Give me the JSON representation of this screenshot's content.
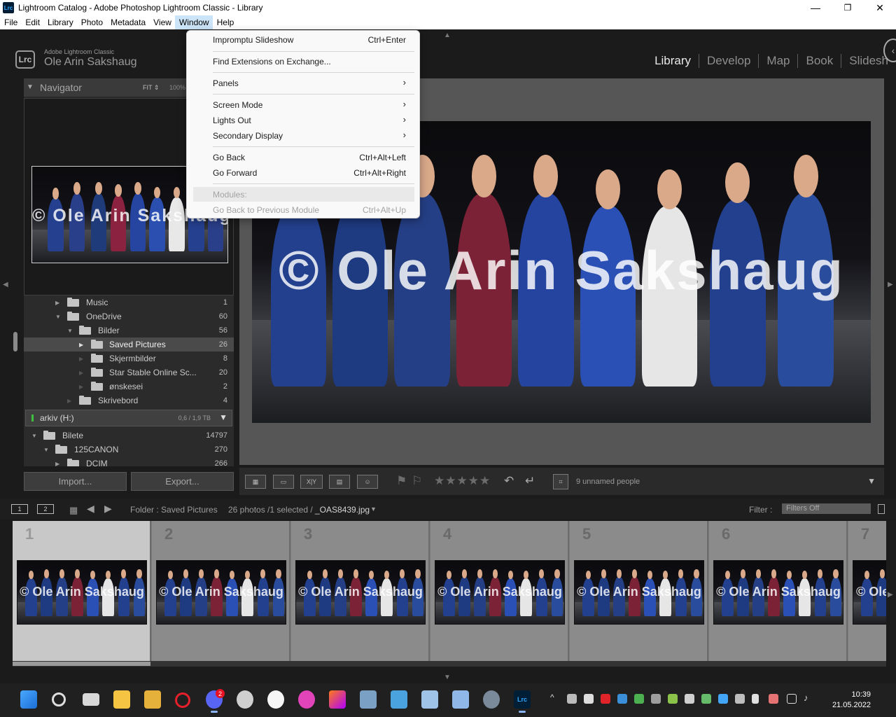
{
  "window": {
    "app_icon": "Lrc",
    "title": "Lightroom Catalog - Adobe Photoshop Lightroom Classic - Library",
    "minimize_glyph": "—",
    "maximize_glyph": "❐",
    "close_glyph": "✕"
  },
  "menubar": [
    "File",
    "Edit",
    "Library",
    "Photo",
    "Metadata",
    "View",
    "Window",
    "Help"
  ],
  "identity": {
    "badge": "Lrc",
    "product": "Adobe Lightroom Classic",
    "user": "Ole Arin Sakshaug"
  },
  "modules": [
    "Library",
    "Develop",
    "Map",
    "Book",
    "Slidesh"
  ],
  "window_menu": {
    "items": [
      {
        "label": "Impromptu Slideshow",
        "shortcut": "Ctrl+Enter"
      },
      {
        "label": "Find Extensions on Exchange...",
        "shortcut": ""
      },
      {
        "label": "Panels",
        "shortcut": "",
        "submenu": "›"
      },
      {
        "label": "Screen Mode",
        "shortcut": "",
        "submenu": "›"
      },
      {
        "label": "Lights Out",
        "shortcut": "",
        "submenu": "›"
      },
      {
        "label": "Secondary Display",
        "shortcut": "",
        "submenu": "›"
      },
      {
        "label": "Go Back",
        "shortcut": "Ctrl+Alt+Left"
      },
      {
        "label": "Go Forward",
        "shortcut": "Ctrl+Alt+Right"
      },
      {
        "label": "Modules:",
        "shortcut": ""
      },
      {
        "label": "Go Back to Previous Module",
        "shortcut": "Ctrl+Alt+Up"
      }
    ]
  },
  "navigator": {
    "title": "Navigator",
    "fit": "FIT ⇕",
    "zoom": "100%"
  },
  "folders": [
    {
      "name": "Music",
      "count": "1"
    },
    {
      "name": "OneDrive",
      "count": "60"
    },
    {
      "name": "Bilder",
      "count": "56"
    },
    {
      "name": "Saved Pictures",
      "count": "26",
      "selected": true
    },
    {
      "name": "Skjermbilder",
      "count": "8"
    },
    {
      "name": "Star Stable Online Sc...",
      "count": "20"
    },
    {
      "name": "ønskesei",
      "count": "2"
    },
    {
      "name": "Skrivebord",
      "count": "4"
    }
  ],
  "volume": {
    "name": "arkiv (H:)",
    "size": "0,6 / 1,9 TB"
  },
  "volume_folders": [
    {
      "name": "Bilete",
      "count": "14797"
    },
    {
      "name": "125CANON",
      "count": "270"
    },
    {
      "name": "DCIM",
      "count": "266"
    }
  ],
  "buttons": {
    "import": "Import...",
    "export": "Export..."
  },
  "photo": {
    "watermark": "© Ole Arin Sakshaug"
  },
  "toolbar": {
    "grid_icon": "grid-view-icon",
    "stars": "★★★★★",
    "people": "9 unnamed people"
  },
  "filmstrip_header": {
    "screen1": "1",
    "screen2": "2",
    "source": "Folder : Saved Pictures",
    "count": "26 photos /1 selected /",
    "file": "_OAS8439.jpg",
    "filter_label": "Filter :",
    "filter_value": "Filters Off"
  },
  "filmstrip": {
    "cells": [
      "1",
      "2",
      "3",
      "4",
      "5",
      "6",
      "7"
    ],
    "watermark": "© Ole Arin Sakshaug"
  },
  "taskbar": {
    "time": "10:39",
    "date": "21.05.2022",
    "discord_badge": "2"
  },
  "colors": {
    "accent_green": "#3fbf3f",
    "lightroom_blue": "#31a8ff",
    "menu_highlight": "#cce4f7"
  }
}
